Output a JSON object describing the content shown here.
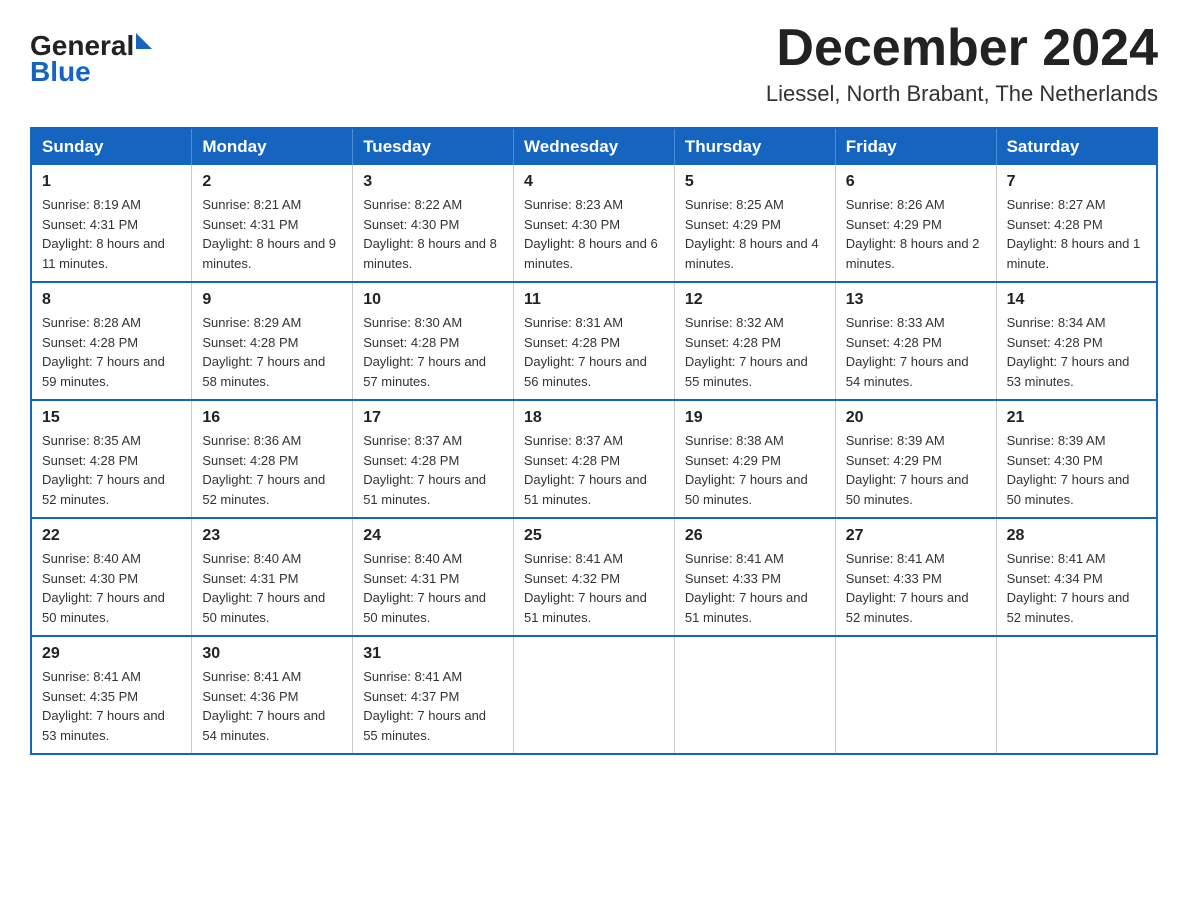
{
  "header": {
    "logo_general": "General",
    "logo_blue": "Blue",
    "month_title": "December 2024",
    "location": "Liessel, North Brabant, The Netherlands"
  },
  "days_of_week": [
    "Sunday",
    "Monday",
    "Tuesday",
    "Wednesday",
    "Thursday",
    "Friday",
    "Saturday"
  ],
  "weeks": [
    [
      {
        "day": "1",
        "sunrise": "8:19 AM",
        "sunset": "4:31 PM",
        "daylight": "8 hours and 11 minutes."
      },
      {
        "day": "2",
        "sunrise": "8:21 AM",
        "sunset": "4:31 PM",
        "daylight": "8 hours and 9 minutes."
      },
      {
        "day": "3",
        "sunrise": "8:22 AM",
        "sunset": "4:30 PM",
        "daylight": "8 hours and 8 minutes."
      },
      {
        "day": "4",
        "sunrise": "8:23 AM",
        "sunset": "4:30 PM",
        "daylight": "8 hours and 6 minutes."
      },
      {
        "day": "5",
        "sunrise": "8:25 AM",
        "sunset": "4:29 PM",
        "daylight": "8 hours and 4 minutes."
      },
      {
        "day": "6",
        "sunrise": "8:26 AM",
        "sunset": "4:29 PM",
        "daylight": "8 hours and 2 minutes."
      },
      {
        "day": "7",
        "sunrise": "8:27 AM",
        "sunset": "4:28 PM",
        "daylight": "8 hours and 1 minute."
      }
    ],
    [
      {
        "day": "8",
        "sunrise": "8:28 AM",
        "sunset": "4:28 PM",
        "daylight": "7 hours and 59 minutes."
      },
      {
        "day": "9",
        "sunrise": "8:29 AM",
        "sunset": "4:28 PM",
        "daylight": "7 hours and 58 minutes."
      },
      {
        "day": "10",
        "sunrise": "8:30 AM",
        "sunset": "4:28 PM",
        "daylight": "7 hours and 57 minutes."
      },
      {
        "day": "11",
        "sunrise": "8:31 AM",
        "sunset": "4:28 PM",
        "daylight": "7 hours and 56 minutes."
      },
      {
        "day": "12",
        "sunrise": "8:32 AM",
        "sunset": "4:28 PM",
        "daylight": "7 hours and 55 minutes."
      },
      {
        "day": "13",
        "sunrise": "8:33 AM",
        "sunset": "4:28 PM",
        "daylight": "7 hours and 54 minutes."
      },
      {
        "day": "14",
        "sunrise": "8:34 AM",
        "sunset": "4:28 PM",
        "daylight": "7 hours and 53 minutes."
      }
    ],
    [
      {
        "day": "15",
        "sunrise": "8:35 AM",
        "sunset": "4:28 PM",
        "daylight": "7 hours and 52 minutes."
      },
      {
        "day": "16",
        "sunrise": "8:36 AM",
        "sunset": "4:28 PM",
        "daylight": "7 hours and 52 minutes."
      },
      {
        "day": "17",
        "sunrise": "8:37 AM",
        "sunset": "4:28 PM",
        "daylight": "7 hours and 51 minutes."
      },
      {
        "day": "18",
        "sunrise": "8:37 AM",
        "sunset": "4:28 PM",
        "daylight": "7 hours and 51 minutes."
      },
      {
        "day": "19",
        "sunrise": "8:38 AM",
        "sunset": "4:29 PM",
        "daylight": "7 hours and 50 minutes."
      },
      {
        "day": "20",
        "sunrise": "8:39 AM",
        "sunset": "4:29 PM",
        "daylight": "7 hours and 50 minutes."
      },
      {
        "day": "21",
        "sunrise": "8:39 AM",
        "sunset": "4:30 PM",
        "daylight": "7 hours and 50 minutes."
      }
    ],
    [
      {
        "day": "22",
        "sunrise": "8:40 AM",
        "sunset": "4:30 PM",
        "daylight": "7 hours and 50 minutes."
      },
      {
        "day": "23",
        "sunrise": "8:40 AM",
        "sunset": "4:31 PM",
        "daylight": "7 hours and 50 minutes."
      },
      {
        "day": "24",
        "sunrise": "8:40 AM",
        "sunset": "4:31 PM",
        "daylight": "7 hours and 50 minutes."
      },
      {
        "day": "25",
        "sunrise": "8:41 AM",
        "sunset": "4:32 PM",
        "daylight": "7 hours and 51 minutes."
      },
      {
        "day": "26",
        "sunrise": "8:41 AM",
        "sunset": "4:33 PM",
        "daylight": "7 hours and 51 minutes."
      },
      {
        "day": "27",
        "sunrise": "8:41 AM",
        "sunset": "4:33 PM",
        "daylight": "7 hours and 52 minutes."
      },
      {
        "day": "28",
        "sunrise": "8:41 AM",
        "sunset": "4:34 PM",
        "daylight": "7 hours and 52 minutes."
      }
    ],
    [
      {
        "day": "29",
        "sunrise": "8:41 AM",
        "sunset": "4:35 PM",
        "daylight": "7 hours and 53 minutes."
      },
      {
        "day": "30",
        "sunrise": "8:41 AM",
        "sunset": "4:36 PM",
        "daylight": "7 hours and 54 minutes."
      },
      {
        "day": "31",
        "sunrise": "8:41 AM",
        "sunset": "4:37 PM",
        "daylight": "7 hours and 55 minutes."
      },
      null,
      null,
      null,
      null
    ]
  ],
  "labels": {
    "sunrise_label": "Sunrise:",
    "sunset_label": "Sunset:",
    "daylight_label": "Daylight:"
  }
}
